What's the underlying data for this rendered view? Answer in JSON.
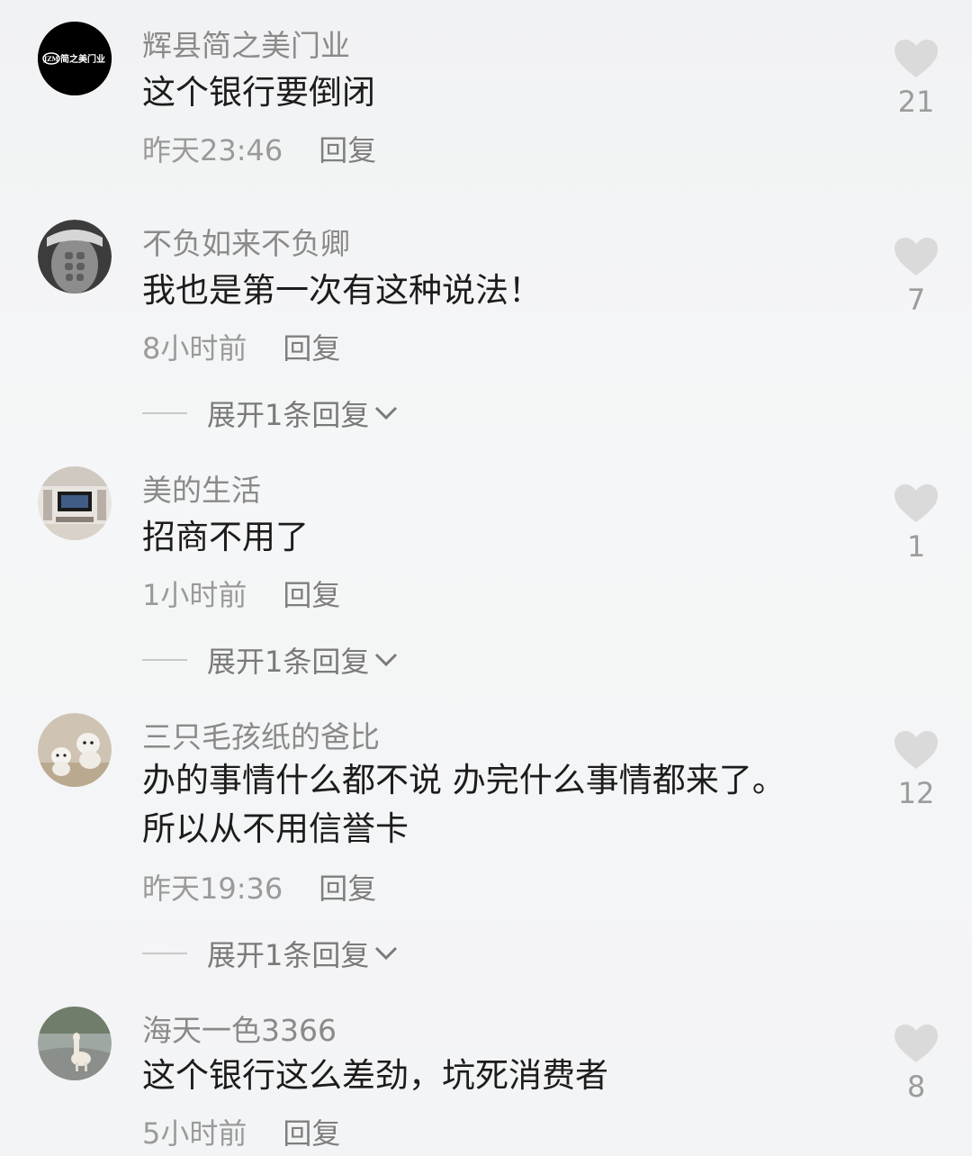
{
  "comments": [
    {
      "username": "辉县简之美门业",
      "text": "这个银行要倒闭",
      "time": "昨天23:46",
      "reply": "回复",
      "likes": "21",
      "avatar": "logo-avatar",
      "avatar_text": "JZM简之美门业"
    },
    {
      "username": "不负如来不负卿",
      "text": "我也是第一次有这种说法！",
      "time": "8小时前",
      "reply": "回复",
      "likes": "7",
      "expand": "展开1条回复",
      "avatar": "muscle-avatar"
    },
    {
      "username": "美的生活",
      "text": "招商不用了",
      "time": "1小时前",
      "reply": "回复",
      "likes": "1",
      "expand": "展开1条回复",
      "avatar": "tv-room-avatar"
    },
    {
      "username": "三只毛孩纸的爸比",
      "text_lines": [
        "办的事情什么都不说 办完什么事情都来了。",
        "所以从不用信誉卡"
      ],
      "time": "昨天19:36",
      "reply": "回复",
      "likes": "12",
      "expand": "展开1条回复",
      "avatar": "puppies-avatar"
    },
    {
      "username": "海天一色3366",
      "text": "这个银行这么差劲，坑死消费者",
      "time": "5小时前",
      "reply": "回复",
      "likes": "8",
      "avatar": "alpaca-avatar"
    }
  ],
  "icons": {
    "like": "heart-icon",
    "expand": "chevron-down-icon"
  }
}
